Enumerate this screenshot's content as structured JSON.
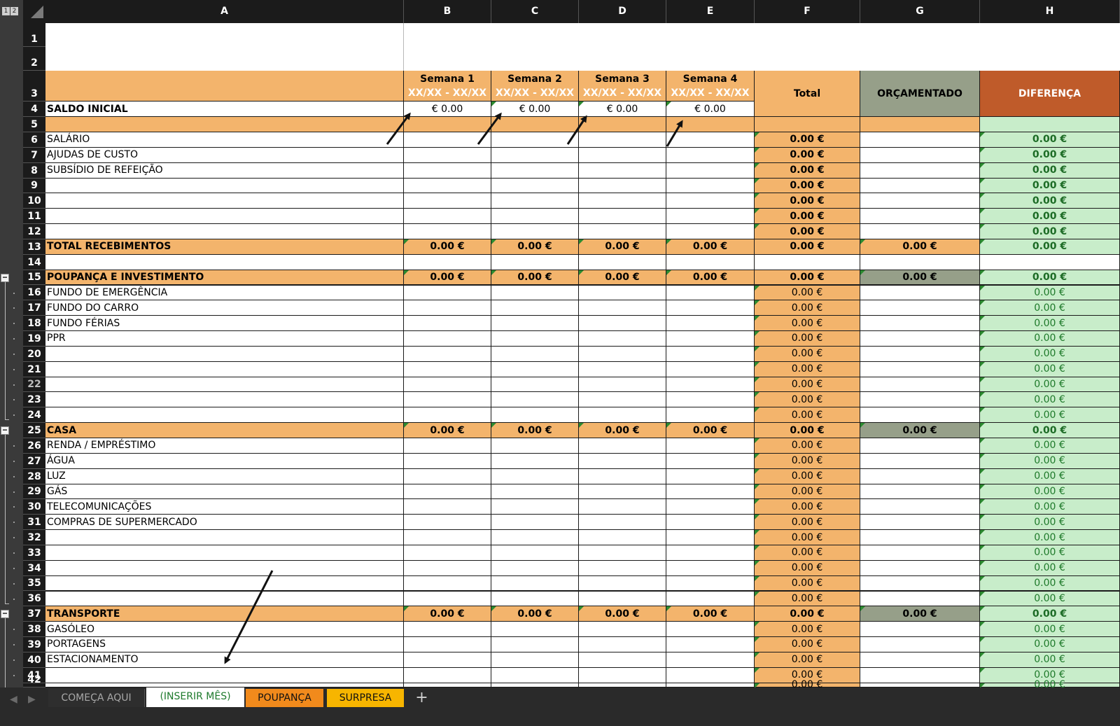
{
  "outline": {
    "levels": [
      "1",
      "2"
    ]
  },
  "columns": [
    "A",
    "B",
    "C",
    "D",
    "E",
    "F",
    "G",
    "H"
  ],
  "header_row": {
    "weeks": [
      {
        "label": "Semana 1",
        "range": "XX/XX - XX/XX"
      },
      {
        "label": "Semana 2",
        "range": "XX/XX - XX/XX"
      },
      {
        "label": "Semana 3",
        "range": "XX/XX - XX/XX"
      },
      {
        "label": "Semana 4",
        "range": "XX/XX - XX/XX"
      }
    ],
    "total": "Total",
    "budget": "ORÇAMENTADO",
    "difference": "DIFERENÇA"
  },
  "saldo": {
    "label": "SALDO INICIAL",
    "values": [
      "€ 0.00",
      "€ 0.00",
      "€ 0.00",
      "€ 0.00"
    ]
  },
  "zero_value": "0.00 €",
  "rows": [
    {
      "n": 6,
      "label": "SALÁRIO",
      "kind": "item"
    },
    {
      "n": 7,
      "label": "AJUDAS DE CUSTO",
      "kind": "item"
    },
    {
      "n": 8,
      "label": "SUBSÍDIO DE REFEIÇÃO",
      "kind": "item"
    },
    {
      "n": 9,
      "label": "",
      "kind": "item"
    },
    {
      "n": 10,
      "label": "",
      "kind": "item"
    },
    {
      "n": 11,
      "label": "",
      "kind": "item"
    },
    {
      "n": 12,
      "label": "",
      "kind": "item"
    },
    {
      "n": 13,
      "label": "TOTAL RECEBIMENTOS",
      "kind": "total"
    },
    {
      "n": 14,
      "label": "",
      "kind": "blank"
    },
    {
      "n": 15,
      "label": "POUPANÇA E INVESTIMENTO",
      "kind": "section"
    },
    {
      "n": 16,
      "label": "FUNDO DE EMERGÊNCIA",
      "kind": "sub"
    },
    {
      "n": 17,
      "label": "FUNDO DO CARRO",
      "kind": "sub"
    },
    {
      "n": 18,
      "label": "FUNDO FÉRIAS",
      "kind": "sub"
    },
    {
      "n": 19,
      "label": "PPR",
      "kind": "sub"
    },
    {
      "n": 20,
      "label": "",
      "kind": "sub"
    },
    {
      "n": 21,
      "label": "",
      "kind": "sub"
    },
    {
      "n": 22,
      "label": "",
      "kind": "sub"
    },
    {
      "n": 23,
      "label": "",
      "kind": "sub"
    },
    {
      "n": 24,
      "label": "",
      "kind": "sub"
    },
    {
      "n": 25,
      "label": "CASA",
      "kind": "section"
    },
    {
      "n": 26,
      "label": "RENDA / EMPRÉSTIMO",
      "kind": "sub"
    },
    {
      "n": 27,
      "label": "ÁGUA",
      "kind": "sub"
    },
    {
      "n": 28,
      "label": "LUZ",
      "kind": "sub"
    },
    {
      "n": 29,
      "label": "GÁS",
      "kind": "sub"
    },
    {
      "n": 30,
      "label": "TELECOMUNICAÇÕES",
      "kind": "sub"
    },
    {
      "n": 31,
      "label": "COMPRAS DE SUPERMERCADO",
      "kind": "sub"
    },
    {
      "n": 32,
      "label": "",
      "kind": "sub"
    },
    {
      "n": 33,
      "label": "",
      "kind": "sub"
    },
    {
      "n": 34,
      "label": "",
      "kind": "sub"
    },
    {
      "n": 35,
      "label": "",
      "kind": "sub"
    },
    {
      "n": 36,
      "label": "",
      "kind": "sub"
    },
    {
      "n": 37,
      "label": "TRANSPORTE",
      "kind": "section"
    },
    {
      "n": 38,
      "label": "GASÓLEO",
      "kind": "sub"
    },
    {
      "n": 39,
      "label": "PORTAGENS",
      "kind": "sub"
    },
    {
      "n": 40,
      "label": "ESTACIONAMENTO",
      "kind": "sub"
    },
    {
      "n": 41,
      "label": "",
      "kind": "sub"
    },
    {
      "n": 42,
      "label": "",
      "kind": "sub"
    }
  ],
  "tabs": [
    {
      "label": "COMEÇA AQUI",
      "style": "dark"
    },
    {
      "label": "(INSERIR MÊS)",
      "style": "active"
    },
    {
      "label": "POUPANÇA",
      "style": "org"
    },
    {
      "label": "SURPRESA",
      "style": "yel"
    },
    {
      "label": "+",
      "style": "add"
    }
  ],
  "nav_icons": [
    "chevron-left-icon",
    "chevron-right-icon"
  ]
}
